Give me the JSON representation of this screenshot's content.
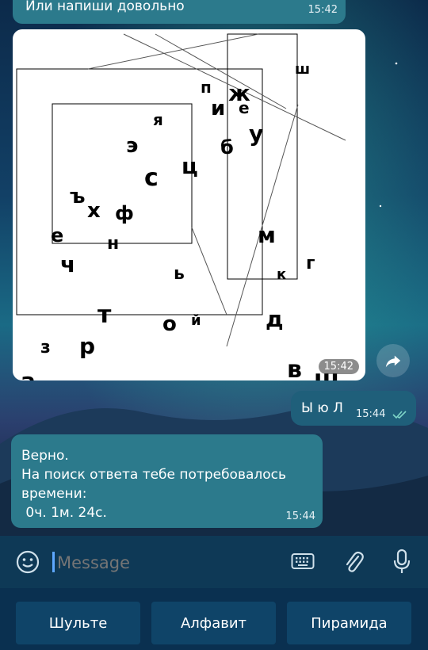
{
  "messages": {
    "top_message": {
      "text": "Или напиши довольно",
      "time": "15:42"
    },
    "image_message": {
      "time": "15:42",
      "letters": [
        {
          "ch": "ж"
        },
        {
          "ch": "ш"
        },
        {
          "ch": "п"
        },
        {
          "ch": "и"
        },
        {
          "ch": "е"
        },
        {
          "ch": "я"
        },
        {
          "ch": "у"
        },
        {
          "ch": "э"
        },
        {
          "ch": "б"
        },
        {
          "ch": "ц"
        },
        {
          "ch": "с"
        },
        {
          "ch": "ъ"
        },
        {
          "ch": "х"
        },
        {
          "ch": "ф"
        },
        {
          "ch": "е"
        },
        {
          "ch": "н"
        },
        {
          "ch": "м"
        },
        {
          "ch": "ч"
        },
        {
          "ch": "г"
        },
        {
          "ch": "ь"
        },
        {
          "ch": "к"
        },
        {
          "ch": "т"
        },
        {
          "ch": "д"
        },
        {
          "ch": "о"
        },
        {
          "ch": "й"
        },
        {
          "ch": "р"
        },
        {
          "ch": "з"
        },
        {
          "ch": "в"
        },
        {
          "ch": "щ"
        },
        {
          "ch": "а"
        }
      ]
    },
    "outgoing": {
      "text": "Ы ю Л",
      "time": "15:44"
    },
    "reply": {
      "line1": "Верно.",
      "line2": "На поиск ответа тебе потребовалось",
      "line3": "времени:",
      "line4": " 0ч. 1м. 24с.",
      "time": "15:44"
    }
  },
  "input": {
    "placeholder": "Message"
  },
  "keyboard": {
    "buttons": [
      "Шульте",
      "Алфавит",
      "Пирамида"
    ]
  },
  "colors": {
    "accent": "#2c7a8c",
    "outgoing": "#1f5f7a",
    "check": "#7fd6c8"
  }
}
